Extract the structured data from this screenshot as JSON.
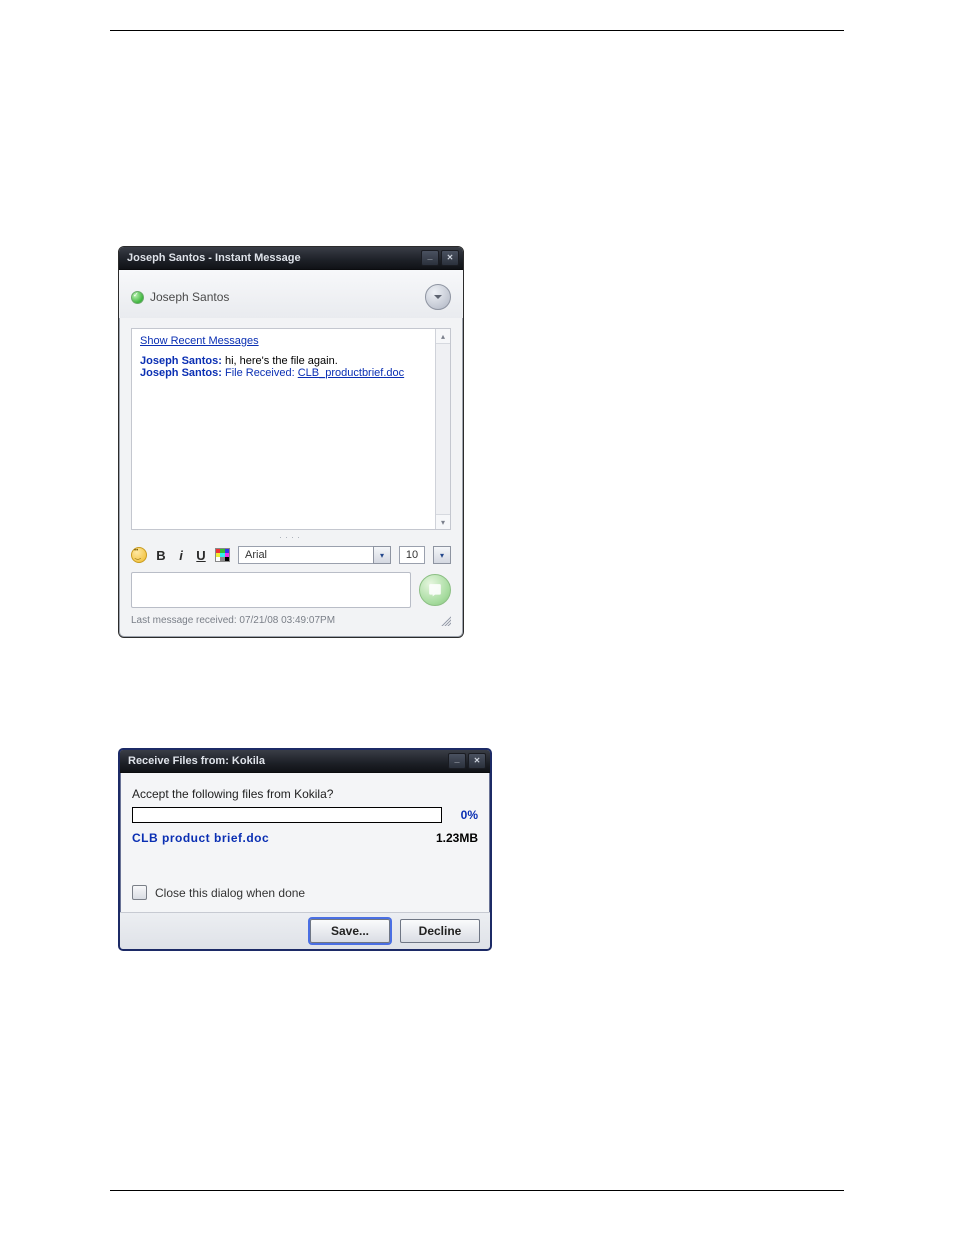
{
  "chat": {
    "title": "Joseph Santos - Instant Message",
    "contact": "Joseph Santos",
    "show_recent": "Show Recent Messages",
    "msg1": {
      "sender": "Joseph Santos:",
      "text": "hi, here's the file again."
    },
    "msg2": {
      "sender": "Joseph Santos:",
      "label": "File Received:",
      "file": "CLB_productbrief.doc"
    },
    "drag_dots": "····",
    "font_name": "Arial",
    "font_size": "10",
    "status": "Last message received: 07/21/08 03:49:07PM"
  },
  "recv": {
    "title": "Receive Files from: Kokila",
    "question": "Accept the following files from Kokila?",
    "percent": "0%",
    "file_name": "CLB product brief.doc",
    "file_size": "1.23MB",
    "close_when_done": "Close this dialog when done",
    "save": "Save...",
    "decline": "Decline"
  }
}
